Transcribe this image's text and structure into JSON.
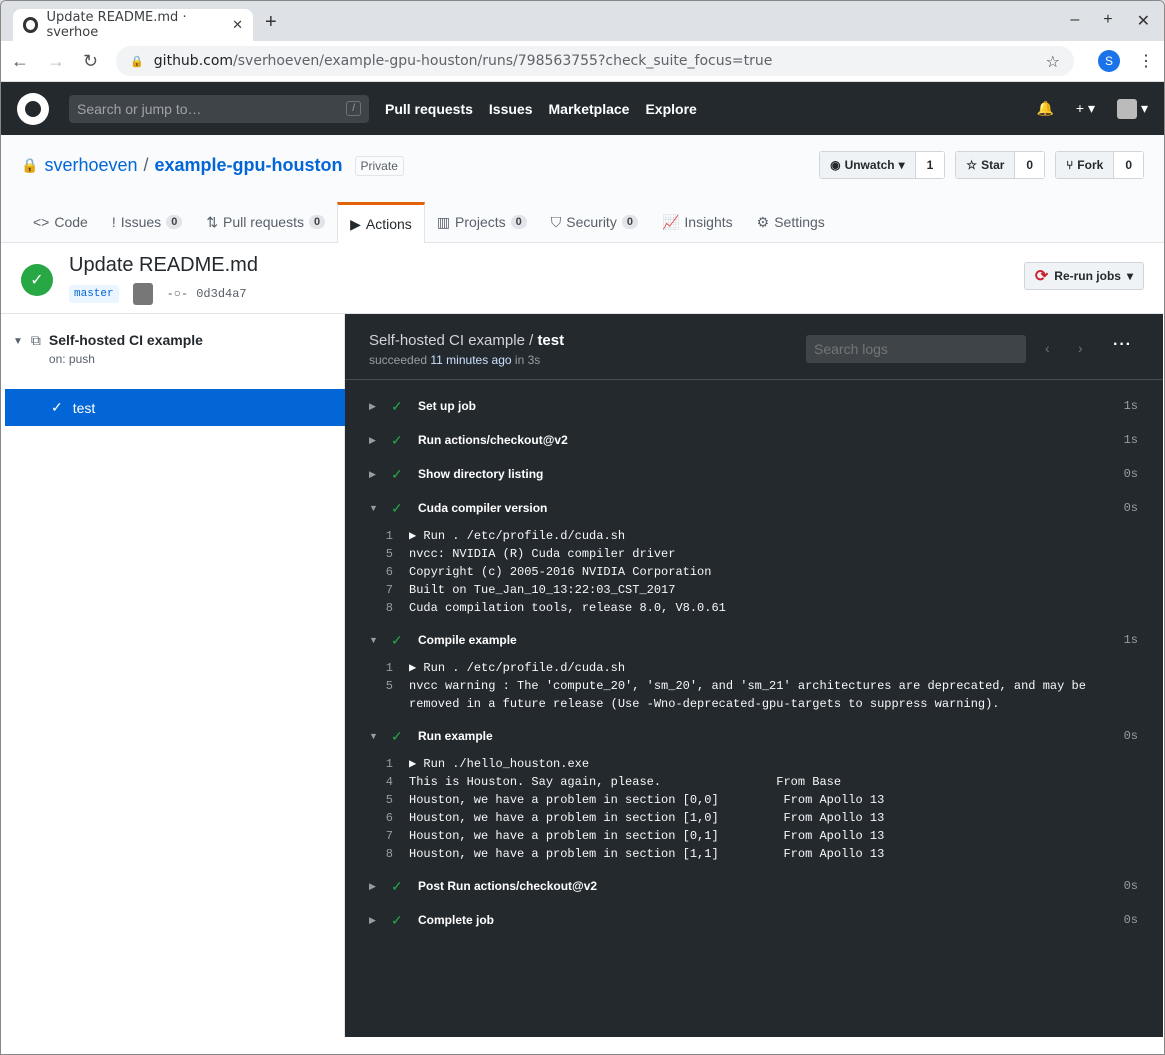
{
  "browser": {
    "tab_title": "Update README.md · sverhoe",
    "url_host": "github.com",
    "url_path": "/sverhoeven/example-gpu-houston/runs/798563755?check_suite_focus=true",
    "profile": "S"
  },
  "header": {
    "search_placeholder": "Search or jump to…",
    "slash": "/",
    "nav": [
      "Pull requests",
      "Issues",
      "Marketplace",
      "Explore"
    ]
  },
  "repo": {
    "owner": "sverhoeven",
    "sep": "/",
    "name": "example-gpu-houston",
    "visibility": "Private",
    "unwatch": "Unwatch",
    "watch_count": "1",
    "star": "Star",
    "star_count": "0",
    "fork": "Fork",
    "fork_count": "0",
    "tabs": [
      {
        "label": "Code",
        "icon": "<>"
      },
      {
        "label": "Issues",
        "count": "0",
        "icon": "!"
      },
      {
        "label": "Pull requests",
        "count": "0",
        "icon": "⇅"
      },
      {
        "label": "Actions",
        "icon": "▶"
      },
      {
        "label": "Projects",
        "count": "0",
        "icon": "▥"
      },
      {
        "label": "Security",
        "count": "0",
        "icon": "⛉"
      },
      {
        "label": "Insights",
        "icon": "📈"
      },
      {
        "label": "Settings",
        "icon": "⚙"
      }
    ]
  },
  "run": {
    "title": "Update README.md",
    "branch": "master",
    "commit": "0d3d4a7",
    "rerun": "Re-run jobs"
  },
  "sidebar": {
    "workflow": "Self-hosted CI example",
    "trigger": "on: push",
    "job": "test"
  },
  "job": {
    "workflow": "Self-hosted CI example",
    "sep": " / ",
    "name": "test",
    "status_prefix": "succeeded ",
    "time": "11 minutes ago",
    "status_suffix": " in 3s",
    "search_placeholder": "Search logs",
    "steps": [
      {
        "name": "Set up job",
        "duration": "1s",
        "expanded": false
      },
      {
        "name": "Run actions/checkout@v2",
        "duration": "1s",
        "expanded": false
      },
      {
        "name": "Show directory listing",
        "duration": "0s",
        "expanded": false
      },
      {
        "name": "Cuda compiler version",
        "duration": "0s",
        "expanded": true,
        "lines": [
          {
            "no": "1",
            "text": "▶ Run . /etc/profile.d/cuda.sh"
          },
          {
            "no": "5",
            "text": "nvcc: NVIDIA (R) Cuda compiler driver"
          },
          {
            "no": "6",
            "text": "Copyright (c) 2005-2016 NVIDIA Corporation"
          },
          {
            "no": "7",
            "text": "Built on Tue_Jan_10_13:22:03_CST_2017"
          },
          {
            "no": "8",
            "text": "Cuda compilation tools, release 8.0, V8.0.61"
          }
        ]
      },
      {
        "name": "Compile example",
        "duration": "1s",
        "expanded": true,
        "lines": [
          {
            "no": "1",
            "text": "▶ Run . /etc/profile.d/cuda.sh"
          },
          {
            "no": "5",
            "text": "nvcc warning : The 'compute_20', 'sm_20', and 'sm_21' architectures are deprecated, and may be"
          },
          {
            "no": "",
            "text": "removed in a future release (Use -Wno-deprecated-gpu-targets to suppress warning)."
          }
        ]
      },
      {
        "name": "Run example",
        "duration": "0s",
        "expanded": true,
        "lines": [
          {
            "no": "1",
            "text": "▶ Run ./hello_houston.exe"
          },
          {
            "no": "4",
            "text": "This is Houston. Say again, please.                From Base"
          },
          {
            "no": "5",
            "text": "Houston, we have a problem in section [0,0]         From Apollo 13"
          },
          {
            "no": "6",
            "text": "Houston, we have a problem in section [1,0]         From Apollo 13"
          },
          {
            "no": "7",
            "text": "Houston, we have a problem in section [0,1]         From Apollo 13"
          },
          {
            "no": "8",
            "text": "Houston, we have a problem in section [1,1]         From Apollo 13"
          }
        ]
      },
      {
        "name": "Post Run actions/checkout@v2",
        "duration": "0s",
        "expanded": false
      },
      {
        "name": "Complete job",
        "duration": "0s",
        "expanded": false
      }
    ]
  }
}
